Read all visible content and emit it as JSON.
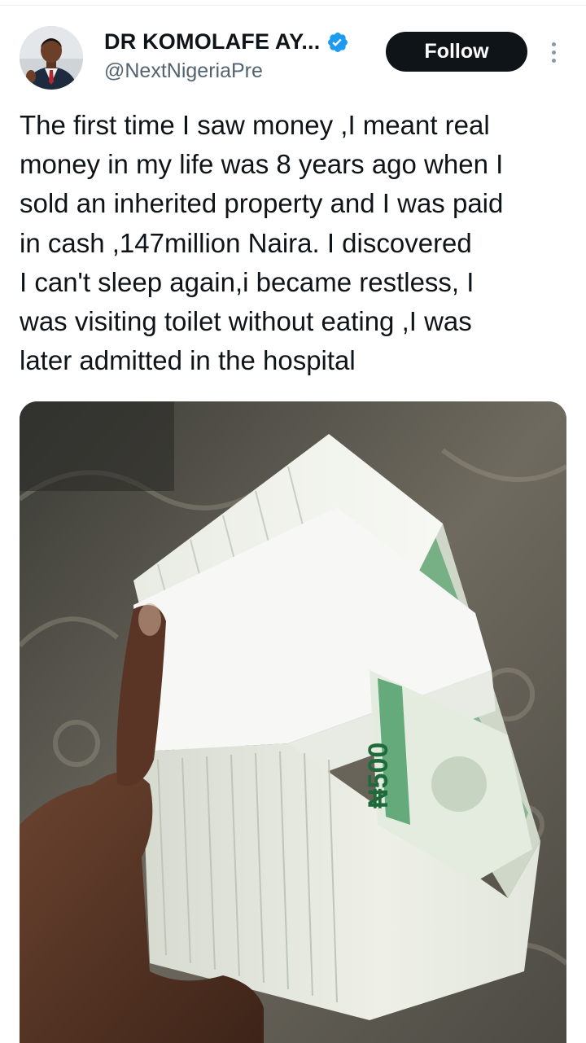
{
  "post": {
    "author": {
      "display_name": "DR KOMOLAFE AY...",
      "handle": "@NextNigeriaPre",
      "verified": true,
      "avatar": "profile-photo"
    },
    "follow_label": "Follow",
    "more_icon": "vertical-ellipsis-icon",
    "text": "The first time I saw money ,I meant real\nmoney in my life was 8 years ago when I\nsold an inherited property and I was paid\nin cash ,147million Naira. I discovered\nI can't sleep again,i became restless, I\nwas visiting toilet without eating ,I was\nlater admitted in the hospital",
    "media": {
      "kind": "photo",
      "subject": "hand-holding-banded-stack-of-naira-notes",
      "note_text": "₦500"
    }
  },
  "colors": {
    "text_primary": "#0f1419",
    "text_secondary": "#536471",
    "verified_blue": "#1d9bf0",
    "follow_bg": "#0f1419",
    "follow_text": "#ffffff",
    "naira_green": "#2f8f4e"
  }
}
